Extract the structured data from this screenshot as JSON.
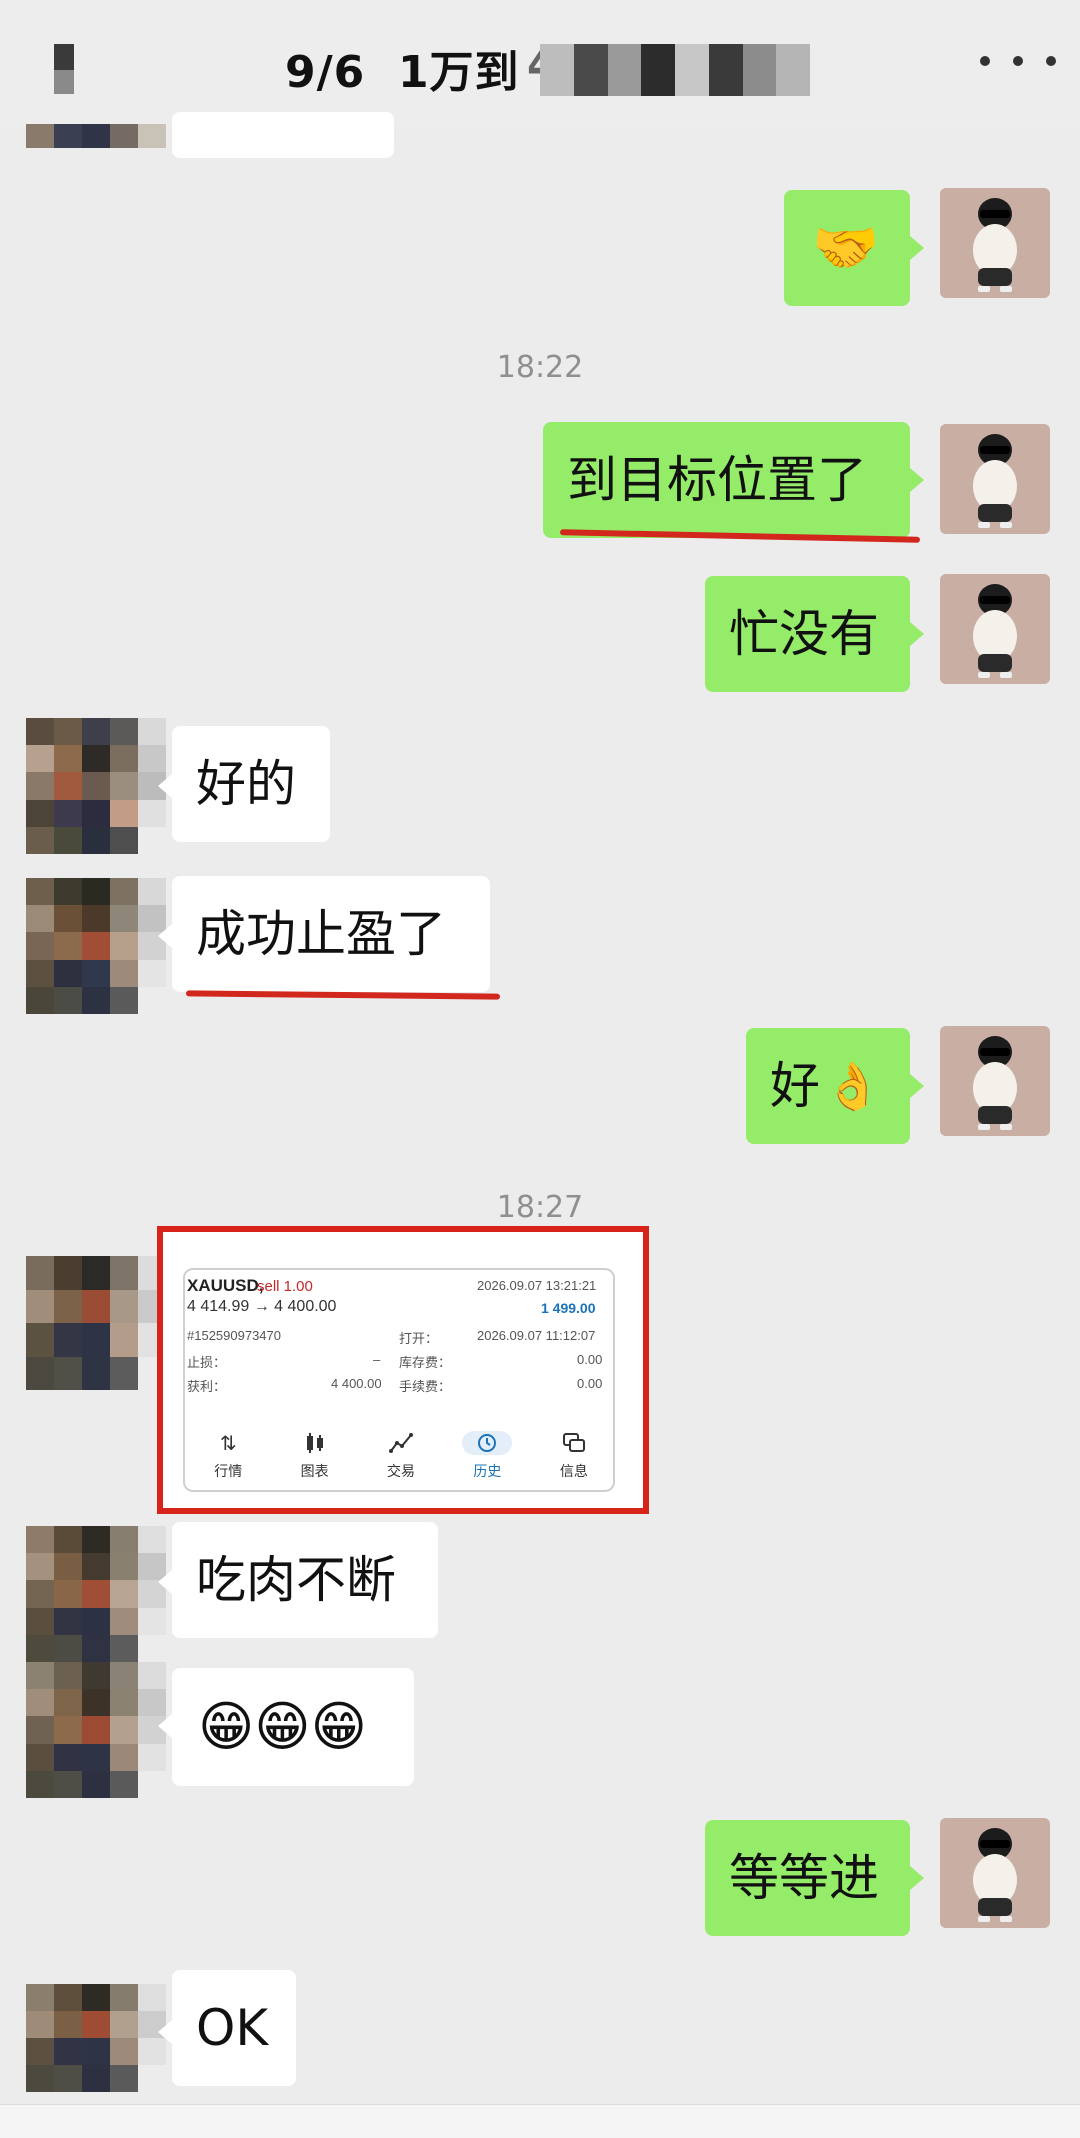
{
  "header": {
    "title": "9/6  1万到",
    "title_digit": "4"
  },
  "messages": {
    "m1_emoji": "🤝",
    "time1": "18:22",
    "m2": "到目标位置了",
    "m3": "忙没有",
    "m4": "好的",
    "m5": "成功止盈了",
    "m6_text": "好",
    "m6_emoji": "👌",
    "time2": "18:27",
    "m8": "吃肉不断",
    "m9_emojis": "😁😁😁",
    "m10": "等等进",
    "m11": "OK"
  },
  "trade_card": {
    "symbol": "XAUUSD,",
    "side": "sell 1.00",
    "prices": "4 414.99 → 4 400.00",
    "close_time": "2026.09.07 13:21:21",
    "profit": "1 499.00",
    "order_id": "#152590973470",
    "open_label": "打开：",
    "open_time": "2026.09.07 11:12:07",
    "sl_label": "止损：",
    "sl_value": "–",
    "swap_label": "库存费：",
    "swap_value": "0.00",
    "tp_label": "获利：",
    "tp_value": "4 400.00",
    "fee_label": "手续费：",
    "fee_value": "0.00",
    "tabs": [
      "行情",
      "图表",
      "交易",
      "历史",
      "信息"
    ]
  },
  "colors": {
    "green_bubble": "#95ec69",
    "annotation_red": "#d2271c",
    "background": "#ececec"
  }
}
